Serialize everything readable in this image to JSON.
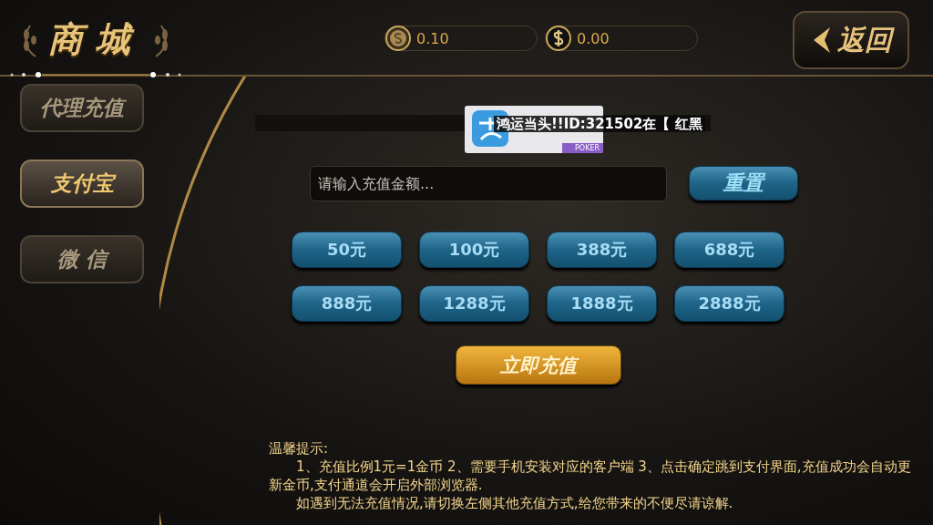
{
  "title": "商城",
  "balances": [
    {
      "kind": "coin",
      "value": "0.10"
    },
    {
      "kind": "dollar",
      "value": "0.00"
    }
  ],
  "back_button": {
    "label": "返回"
  },
  "sidebar": {
    "items": [
      {
        "label": "代理充值",
        "selected": false
      },
      {
        "label": "支付宝",
        "selected": true
      },
      {
        "label": "微 信",
        "selected": false
      }
    ]
  },
  "marquee": {
    "text": "鸿运当头!!ID:321502在【 红黑",
    "logo_badge": "POKER"
  },
  "amount_field": {
    "placeholder": "请输入充值金额..."
  },
  "reset_button": {
    "label": "重置"
  },
  "amounts": [
    "50元",
    "100元",
    "388元",
    "688元",
    "888元",
    "1288元",
    "1888元",
    "2888元"
  ],
  "recharge_button": {
    "label": "立即充值"
  },
  "tips": {
    "heading": "温馨提示:",
    "paragraphs": [
      "1、充值比例1元=1金币 2、需要手机安装对应的客户端 3、点击确定跳到支付界面,充值成功会自动更新金币,支付通道会开启外部浏览器.",
      "如遇到无法充值情况,请切换左侧其他充值方式,给您带来的不便尽请谅解."
    ]
  }
}
